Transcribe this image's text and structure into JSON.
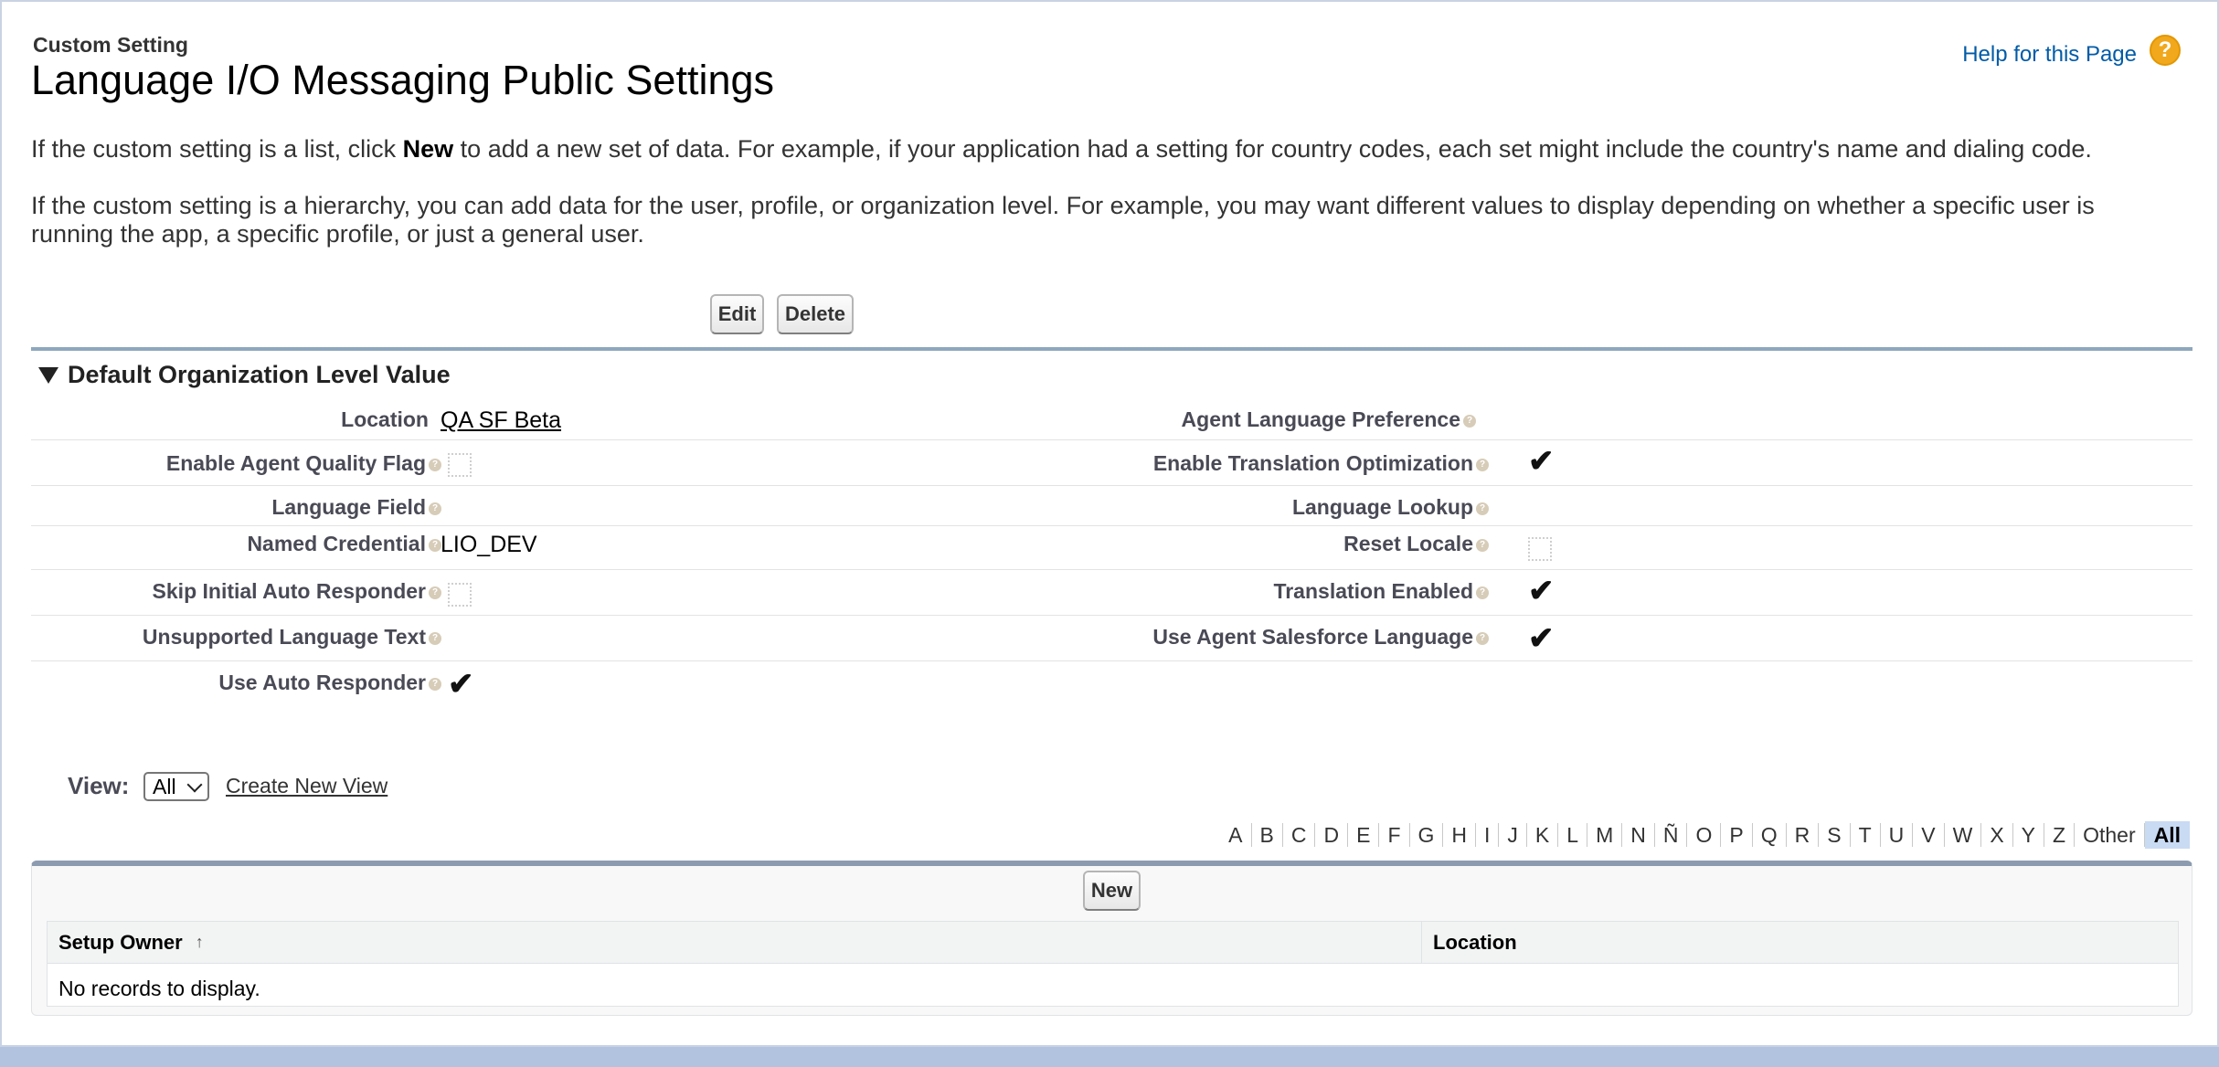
{
  "header": {
    "breadcrumb": "Custom Setting",
    "title": "Language I/O Messaging Public Settings",
    "help_link": "Help for this Page",
    "help_icon": "?"
  },
  "intro": {
    "list_text_before": "If the custom setting is a list, click ",
    "list_text_bold": "New",
    "list_text_after": " to add a new set of data. For example, if your application had a setting for country codes, each set might include the country's name and dialing code.",
    "hierarchy_text": "If the custom setting is a hierarchy, you can add data for the user, profile, or organization level. For example, you may want different values to display depending on whether a specific user is running the app, a specific profile, or just a general user."
  },
  "buttons": {
    "edit": "Edit",
    "delete": "Delete",
    "new": "New"
  },
  "section": {
    "title": "Default Organization Level Value",
    "info_glyph": "?",
    "check_glyph": "✔",
    "fields": {
      "location": {
        "label": "Location",
        "value": "QA SF Beta"
      },
      "agent_language_preference": {
        "label": "Agent Language Preference",
        "value": ""
      },
      "enable_agent_quality_flag": {
        "label": "Enable Agent Quality Flag",
        "checked": false
      },
      "enable_translation_optimization": {
        "label": "Enable Translation Optimization",
        "checked": true
      },
      "language_field": {
        "label": "Language Field",
        "value": ""
      },
      "language_lookup": {
        "label": "Language Lookup",
        "value": ""
      },
      "named_credential": {
        "label": "Named Credential",
        "value": "LIO_DEV"
      },
      "reset_locale": {
        "label": "Reset Locale",
        "checked": false
      },
      "skip_initial_auto_responder": {
        "label": "Skip Initial Auto Responder",
        "checked": false
      },
      "translation_enabled": {
        "label": "Translation Enabled",
        "checked": true
      },
      "unsupported_language_text": {
        "label": "Unsupported Language Text",
        "value": ""
      },
      "use_agent_salesforce_language": {
        "label": "Use Agent Salesforce Language",
        "checked": true
      },
      "use_auto_responder": {
        "label": "Use Auto Responder",
        "checked": true
      }
    }
  },
  "view": {
    "label": "View:",
    "selected": "All",
    "create_link": "Create New View"
  },
  "alpha_filter": [
    "A",
    "B",
    "C",
    "D",
    "E",
    "F",
    "G",
    "H",
    "I",
    "J",
    "K",
    "L",
    "M",
    "N",
    "Ñ",
    "O",
    "P",
    "Q",
    "R",
    "S",
    "T",
    "U",
    "V",
    "W",
    "X",
    "Y",
    "Z",
    "Other",
    "All"
  ],
  "alpha_active": "All",
  "list": {
    "columns": [
      "Setup Owner",
      "Location"
    ],
    "sort_glyph": "↑",
    "empty_message": "No records to display."
  },
  "colors": {
    "help_link": "#015ba7",
    "section_line": "#8da7bd",
    "alpha_active_bg": "#c9daf3",
    "page_border": "#b2c3e0"
  }
}
